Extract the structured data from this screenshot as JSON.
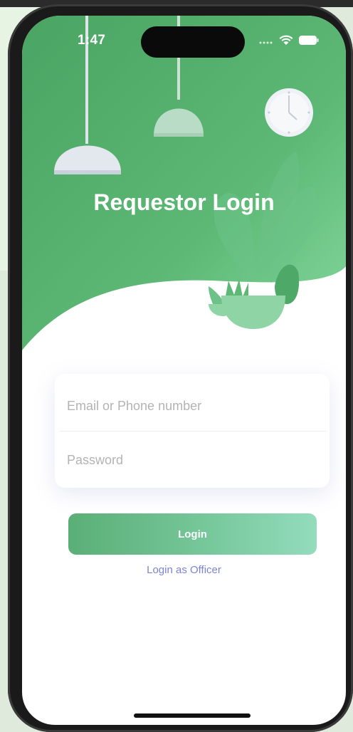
{
  "status_bar": {
    "time": "1:47",
    "cellular_icon": "signal-dots-icon",
    "wifi_icon": "wifi-icon",
    "battery_icon": "battery-icon"
  },
  "header": {
    "title": "Requestor Login"
  },
  "illustration": {
    "elements": [
      "pendant-lamp-icon",
      "pendant-lamp-icon",
      "wall-clock-icon",
      "potted-plant-icon"
    ]
  },
  "form": {
    "email_placeholder": "Email or Phone number",
    "password_placeholder": "Password",
    "login_label": "Login",
    "officer_link_label": "Login as Officer"
  },
  "colors": {
    "hero_green": "#5ab471",
    "hero_green_light": "#7fd49a",
    "button_gradient_start": "#5aaf76",
    "button_gradient_end": "#93dcbd",
    "link_color": "#7b83d8"
  }
}
